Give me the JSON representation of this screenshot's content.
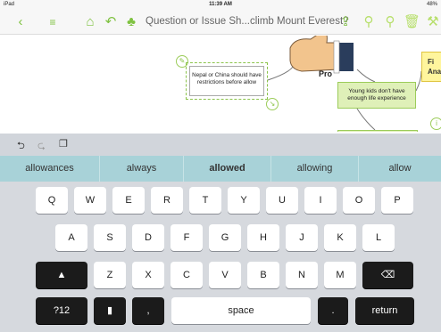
{
  "status": {
    "device": "iPad",
    "time": "11:39 AM",
    "battery": "48%"
  },
  "toolbar": {
    "title": "Question or Issue  Sh...climb Mount Everest?",
    "icons": [
      "chevron-left-icon",
      "list-icon",
      "home-icon",
      "undo-icon",
      "hierarchy-icon",
      "share-icon",
      "add-child-icon",
      "add-sibling-icon",
      "trash-icon",
      "tool-icon"
    ]
  },
  "canvas": {
    "focused_node": {
      "text": "Nepal or China should have restrictions before allow"
    },
    "pro_label": "Pro",
    "kids_node": {
      "text": "Young kids don't have enough life experience"
    },
    "right_node": {
      "text": "Fi Ana"
    }
  },
  "editbar": {
    "undo": "⮌",
    "redo": "⮎",
    "copy": "❐"
  },
  "suggestions": [
    "allowances",
    "always",
    "allowed",
    "allowing",
    "allow"
  ],
  "keyboard": {
    "row1": [
      "Q",
      "W",
      "E",
      "R",
      "T",
      "Y",
      "U",
      "I",
      "O",
      "P"
    ],
    "row2": [
      "A",
      "S",
      "D",
      "F",
      "G",
      "H",
      "J",
      "K",
      "L"
    ],
    "row3": [
      "Z",
      "X",
      "C",
      "V",
      "B",
      "N",
      "M"
    ],
    "numbers": "?12",
    "space": "space",
    "period": ".",
    "comma": ",",
    "return": "return"
  },
  "colors": {
    "accent": "#7fc241",
    "suggest_bar": "#a8d2d8"
  }
}
